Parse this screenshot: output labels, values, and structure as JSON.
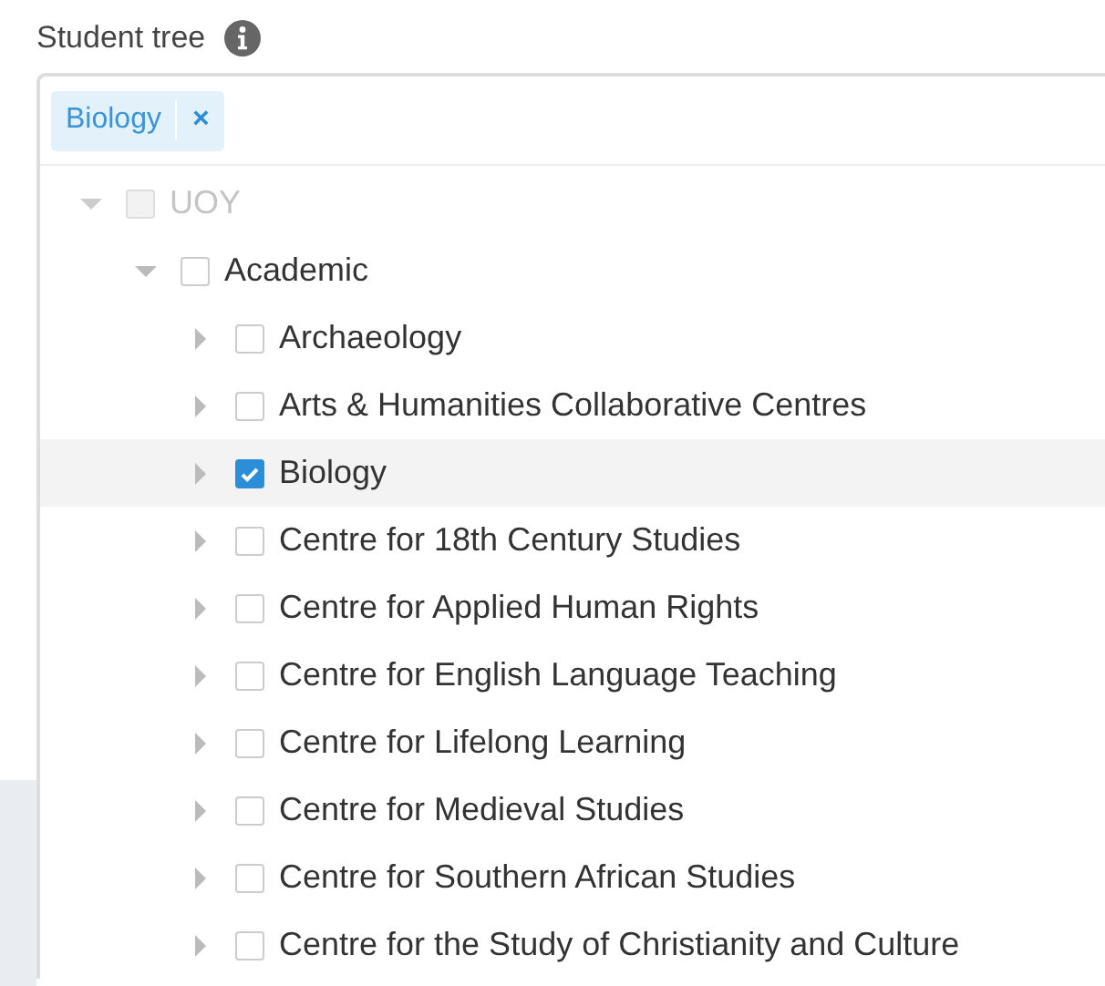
{
  "field": {
    "label": "Student tree"
  },
  "tags": [
    {
      "label": "Biology",
      "remove": "×"
    }
  ],
  "tree": [
    {
      "label": "UOY",
      "expanded": true,
      "checked": false,
      "disabled": true,
      "selected": false,
      "children": [
        {
          "label": "Academic",
          "expanded": true,
          "checked": false,
          "disabled": false,
          "selected": false,
          "children": [
            {
              "label": "Archaeology",
              "expanded": false,
              "checked": false,
              "disabled": false,
              "selected": false
            },
            {
              "label": "Arts & Humanities Collaborative Centres",
              "expanded": false,
              "checked": false,
              "disabled": false,
              "selected": false
            },
            {
              "label": "Biology",
              "expanded": false,
              "checked": true,
              "disabled": false,
              "selected": true
            },
            {
              "label": "Centre for 18th Century Studies",
              "expanded": false,
              "checked": false,
              "disabled": false,
              "selected": false
            },
            {
              "label": "Centre for Applied Human Rights",
              "expanded": false,
              "checked": false,
              "disabled": false,
              "selected": false
            },
            {
              "label": "Centre for English Language Teaching",
              "expanded": false,
              "checked": false,
              "disabled": false,
              "selected": false
            },
            {
              "label": "Centre for Lifelong Learning",
              "expanded": false,
              "checked": false,
              "disabled": false,
              "selected": false
            },
            {
              "label": "Centre for Medieval Studies",
              "expanded": false,
              "checked": false,
              "disabled": false,
              "selected": false
            },
            {
              "label": "Centre for Southern African Studies",
              "expanded": false,
              "checked": false,
              "disabled": false,
              "selected": false
            },
            {
              "label": "Centre for the Study of Christianity and Culture",
              "expanded": false,
              "checked": false,
              "disabled": false,
              "selected": false
            }
          ]
        }
      ]
    }
  ]
}
